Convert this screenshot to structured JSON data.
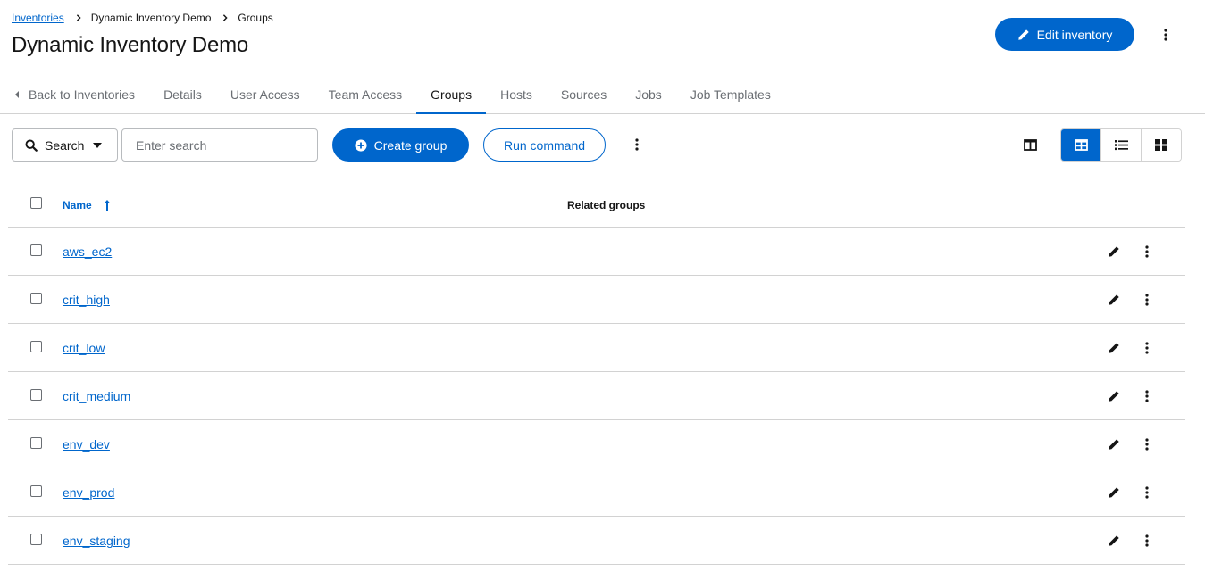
{
  "breadcrumb": {
    "items": [
      {
        "label": "Inventories",
        "link": true
      },
      {
        "label": "Dynamic Inventory Demo",
        "link": false
      },
      {
        "label": "Groups",
        "link": false
      }
    ]
  },
  "header": {
    "title": "Dynamic Inventory Demo",
    "edit_label": "Edit inventory"
  },
  "tabs": [
    {
      "label": "Back to Inventories",
      "active": false
    },
    {
      "label": "Details",
      "active": false
    },
    {
      "label": "User Access",
      "active": false
    },
    {
      "label": "Team Access",
      "active": false
    },
    {
      "label": "Groups",
      "active": true
    },
    {
      "label": "Hosts",
      "active": false
    },
    {
      "label": "Sources",
      "active": false
    },
    {
      "label": "Jobs",
      "active": false
    },
    {
      "label": "Job Templates",
      "active": false
    }
  ],
  "toolbar": {
    "search_label": "Search",
    "search_placeholder": "Enter search",
    "create_label": "Create group",
    "run_label": "Run command"
  },
  "table": {
    "columns": [
      "Name",
      "Related groups"
    ],
    "rows": [
      {
        "name": "aws_ec2"
      },
      {
        "name": "crit_high"
      },
      {
        "name": "crit_low"
      },
      {
        "name": "crit_medium"
      },
      {
        "name": "env_dev"
      },
      {
        "name": "env_prod"
      },
      {
        "name": "env_staging"
      }
    ]
  },
  "colors": {
    "accent": "#0066cc",
    "text": "#151515",
    "muted": "#6a6e73",
    "border": "#d2d2d2"
  }
}
